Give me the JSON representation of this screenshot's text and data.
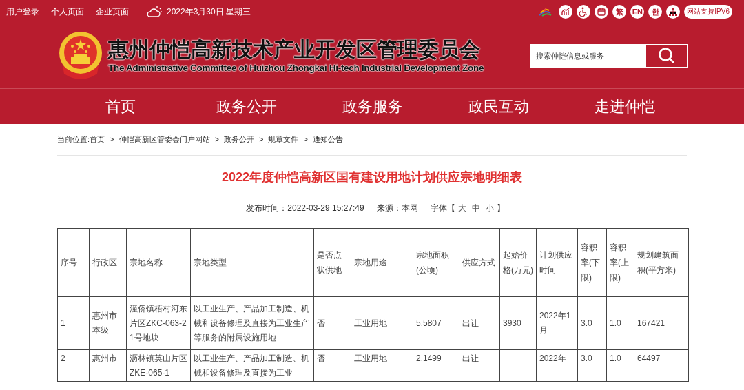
{
  "top_bar": {
    "links": [
      "用户登录",
      "个人页面",
      "企业页面"
    ],
    "date": "2022年3月30日 星期三",
    "lang_buttons": [
      "繁",
      "EN",
      "한"
    ],
    "ipv6_badge": "网站支持IPV6"
  },
  "header": {
    "title": "惠州仲恺高新技术产业开发区管理委员会",
    "subtitle": "The Administrative Committee of Huizhou Zhongkai Hi-tech Industrial Development Zone",
    "search": {
      "placeholder": "搜索仲恺信息或服务"
    }
  },
  "nav": [
    {
      "label": "首页"
    },
    {
      "label": "政务公开"
    },
    {
      "label": "政务服务"
    },
    {
      "label": "政民互动"
    },
    {
      "label": "走进仲恺"
    }
  ],
  "breadcrumb": {
    "prefix": "当前位置:",
    "items": [
      {
        "label": "首页"
      },
      {
        "separator": ">",
        "label": "仲恺高新区管委会门户网站"
      },
      {
        "separator": ">",
        "label": "政务公开"
      },
      {
        "separator": ">",
        "label": "规章文件"
      },
      {
        "separator": ">",
        "label": "通知公告"
      }
    ]
  },
  "article": {
    "title": "2022年度仲恺高新区国有建设用地计划供应宗地明细表",
    "published": "发布时间：2022-03-29 15:27:49",
    "source": "来源：本网",
    "font_label": "字体【",
    "font_sizes": [
      "大",
      "中",
      "小"
    ],
    "font_close": "】"
  },
  "table": {
    "columns": [
      "序号",
      "行政区",
      "宗地名称",
      "宗地类型",
      "是否点状供地",
      "宗地用途",
      "宗地面积(公顷)",
      "供应方式",
      "起始价格(万元)",
      "计划供应时间",
      "容积率(下限)",
      "容积率(上限)",
      "规划建筑面积(平方米)"
    ],
    "rows": [
      [
        "1",
        "惠州市本级",
        "潼侨镇梧村河东片区ZKC-063-21号地块",
        "以工业生产、产品加工制造、机械和设备修理及直接为工业生产等服务的附属设施用地",
        "否",
        "工业用地",
        "5.5807",
        "出让",
        "3930",
        "2022年1月",
        "3.0",
        "1.0",
        "167421"
      ],
      [
        "2",
        "惠州市",
        "沥林镇英山片区ZKE-065-1",
        "以工业生产、产品加工制造、机械和设备修理及直接为工业",
        "否",
        "工业用地",
        "2.1499",
        "出让",
        "",
        "2022年",
        "3.0",
        "1.0",
        "64497"
      ]
    ]
  }
}
